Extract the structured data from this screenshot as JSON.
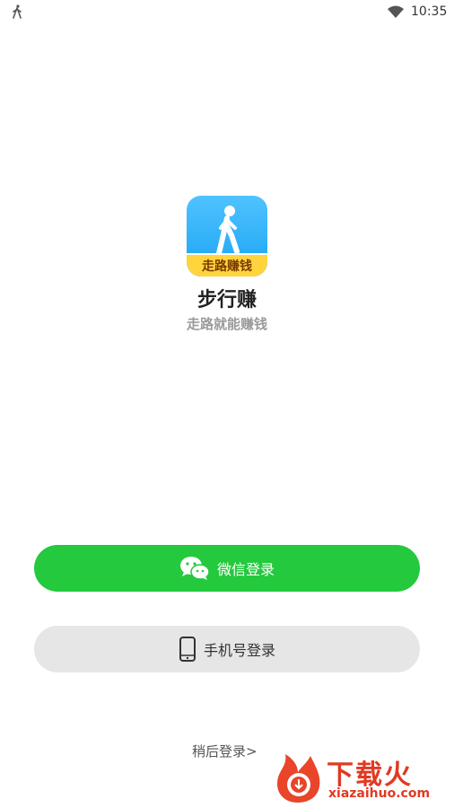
{
  "status_bar": {
    "time": "10:35",
    "activity_icon": "walking-icon",
    "wifi_icon": "wifi-icon"
  },
  "app": {
    "name": "步行赚",
    "slogan": "走路就能赚钱",
    "icon_badge": "走路赚钱"
  },
  "buttons": {
    "wechat_login": "微信登录",
    "phone_login": "手机号登录"
  },
  "later_login": "稍后登录>",
  "watermark": {
    "brand_cn": "下载火",
    "url": "xiazaihuo.com"
  },
  "colors": {
    "wechat_green": "#24c93e",
    "phone_gray": "#e6e6e6",
    "watermark_red": "#e03a22"
  }
}
